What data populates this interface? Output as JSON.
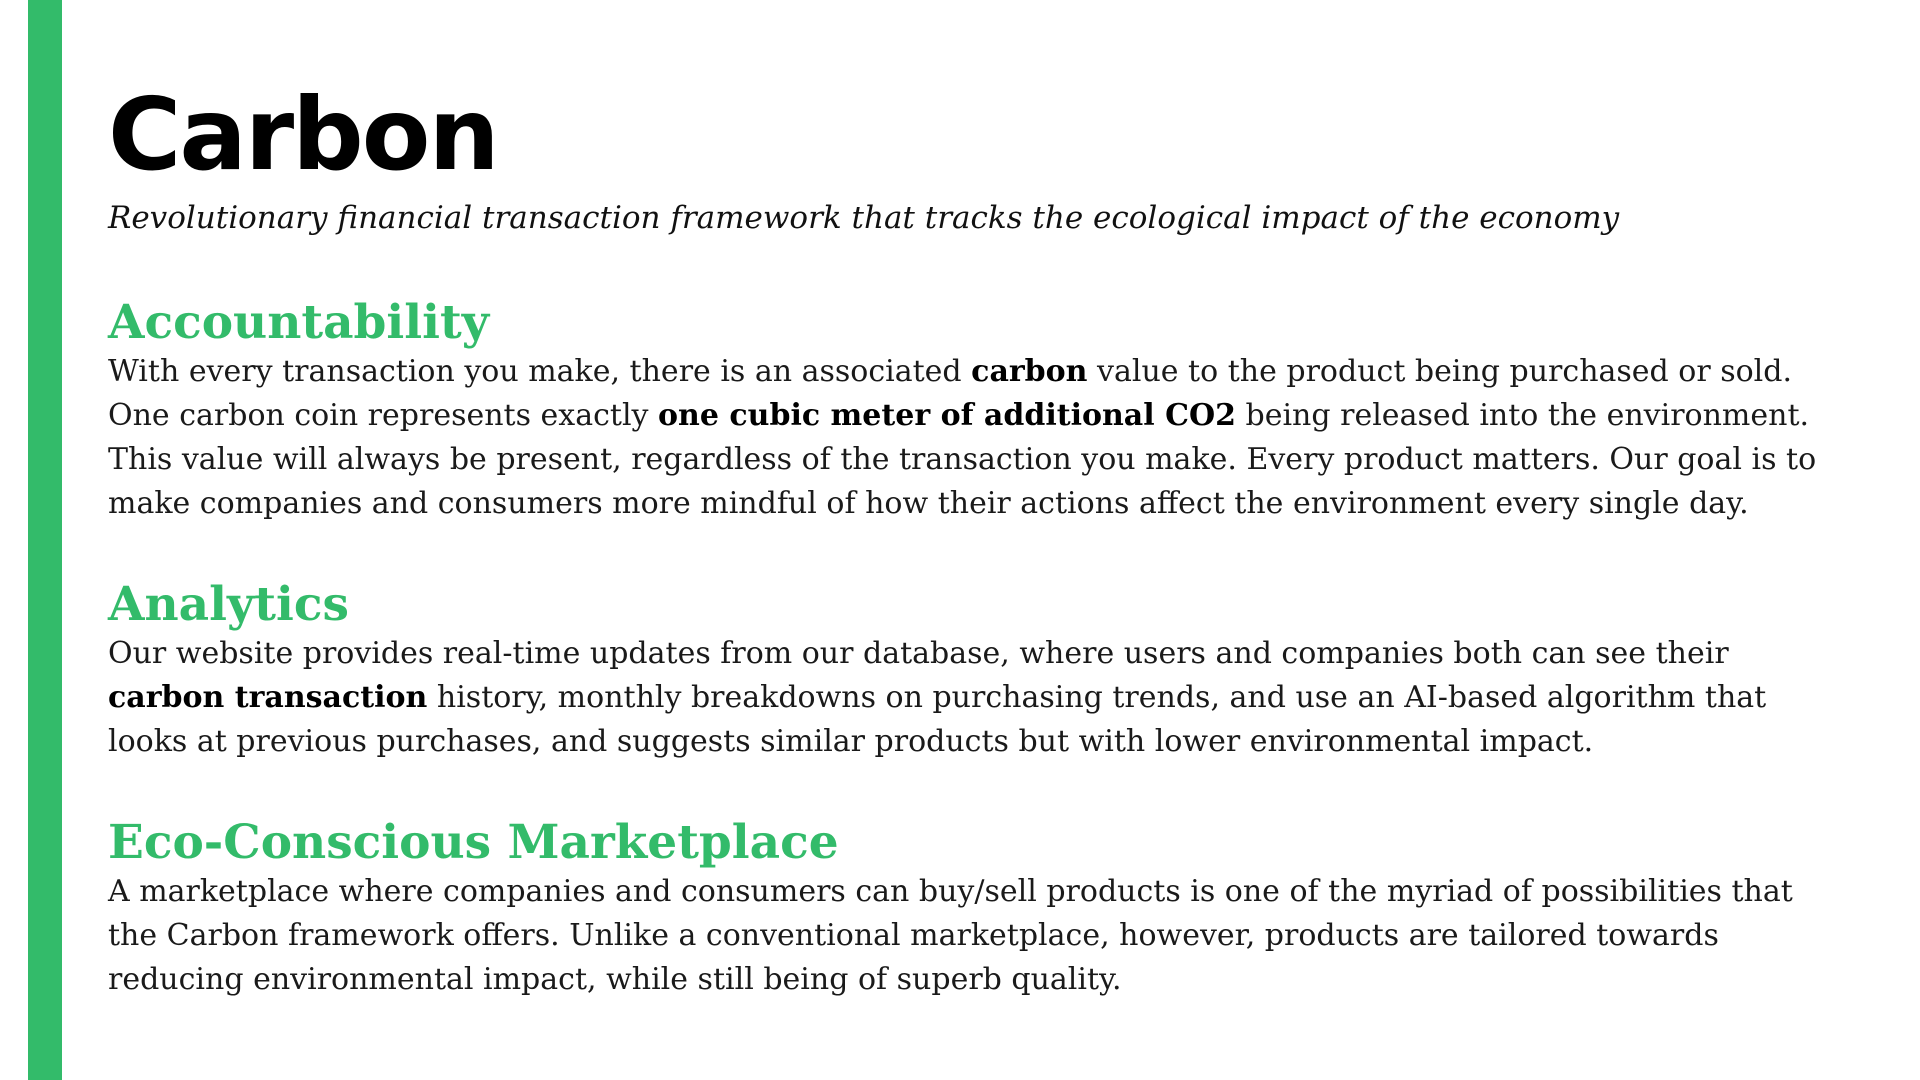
{
  "colors": {
    "accent": "#33bb6a",
    "text": "#1a1a1a",
    "background": "#ffffff"
  },
  "header": {
    "title": "Carbon",
    "tagline": "Revolutionary financial transaction framework that tracks the ecological impact of the economy"
  },
  "sections": [
    {
      "heading": "Accountability",
      "body": [
        {
          "text": "With every transaction you make, there is an associated ",
          "bold": false
        },
        {
          "text": "carbon",
          "bold": true
        },
        {
          "text": " value to the product being purchased or sold. One carbon coin represents exactly ",
          "bold": false
        },
        {
          "text": "one cubic meter of additional CO2",
          "bold": true
        },
        {
          "text": " being released into the environment. This value will always be present, regardless of the transaction you make. Every product matters. Our goal is to make companies and consumers more mindful of how their actions affect the environment every single day.",
          "bold": false
        }
      ]
    },
    {
      "heading": "Analytics",
      "body": [
        {
          "text": "Our website provides real-time updates from our database, where users and companies both can see their ",
          "bold": false
        },
        {
          "text": "carbon transaction",
          "bold": true
        },
        {
          "text": " history, monthly breakdowns on purchasing trends, and use an AI-based algorithm that looks at previous purchases, and suggests similar products but with lower environmental impact.",
          "bold": false
        }
      ]
    },
    {
      "heading": "Eco-Conscious Marketplace",
      "body": [
        {
          "text": "A marketplace where companies and consumers can buy/sell products is one of the myriad of possibilities that the Carbon framework offers. Unlike a conventional marketplace, however, products are tailored towards reducing environmental impact, while still being of superb quality.",
          "bold": false
        }
      ]
    }
  ]
}
